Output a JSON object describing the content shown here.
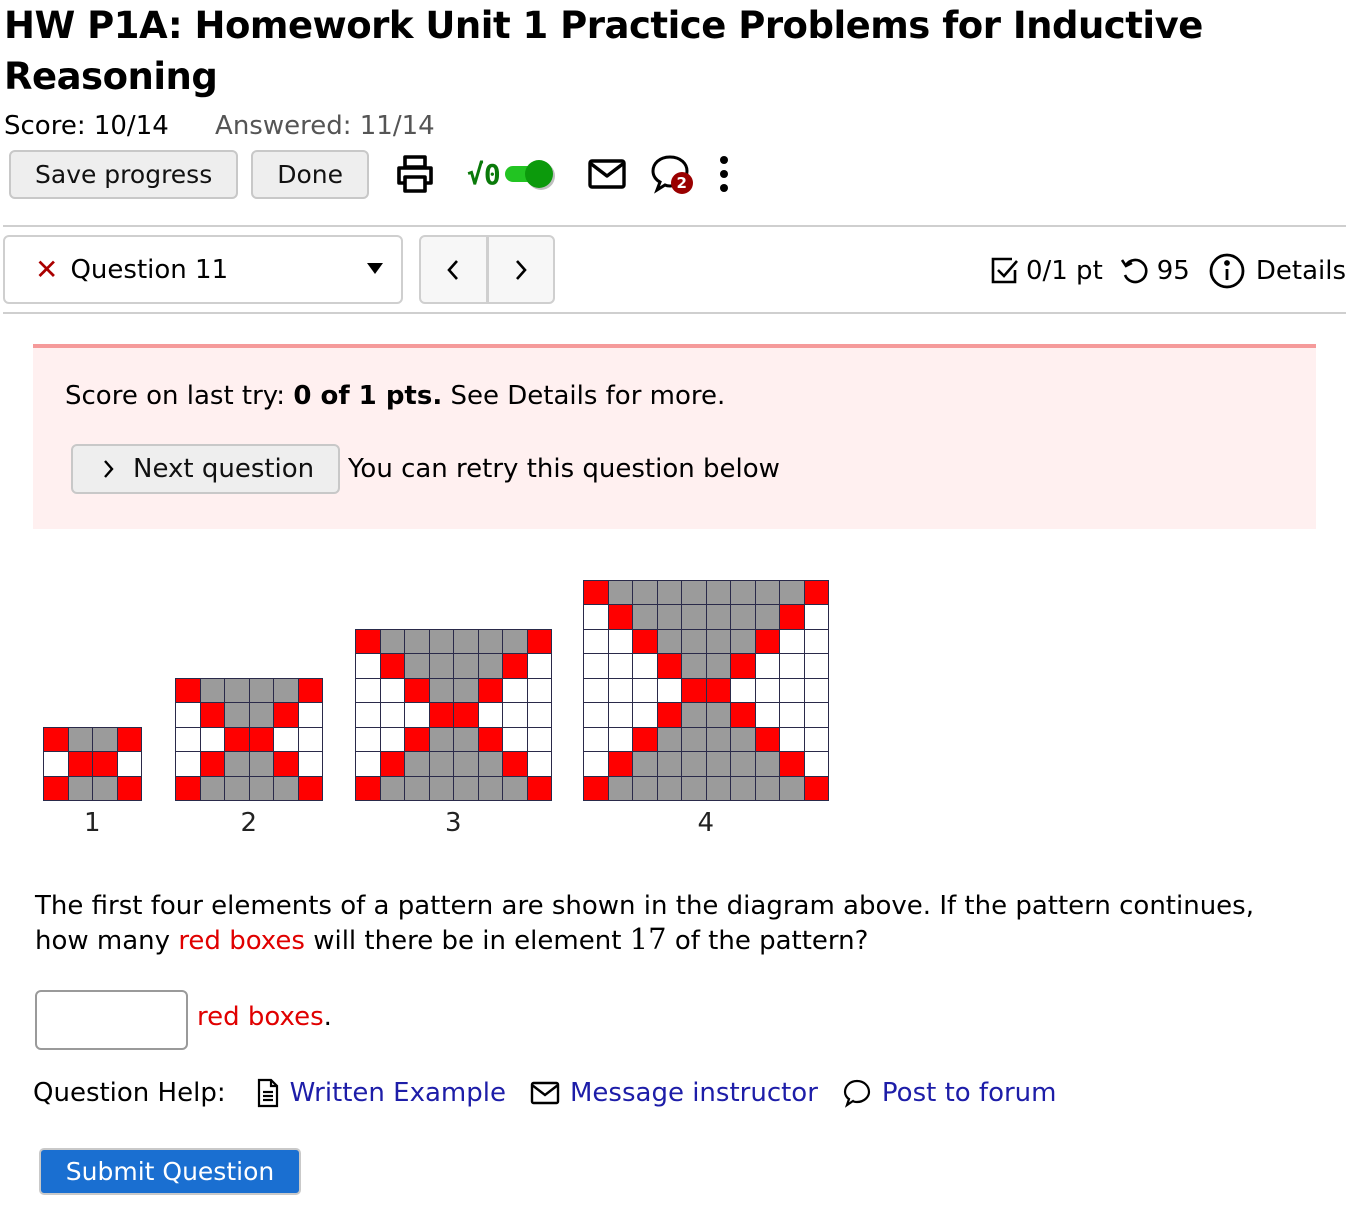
{
  "page": {
    "title": "HW P1A: Homework Unit 1 Practice Problems for Inductive Reasoning",
    "score": "Score: 10/14",
    "answered": "Answered: 11/14"
  },
  "toolbar": {
    "save_label": "Save progress",
    "done_label": "Done",
    "icons": [
      "print-icon",
      "math-entry-toggle",
      "mail-icon",
      "chat-notifications-icon",
      "more-options-icon"
    ],
    "math_toggle_label": "√0",
    "math_toggle_on": true,
    "notification_count": "2"
  },
  "question_nav": {
    "selected": "Question 11",
    "status_icon": "incorrect-x-icon",
    "prev_icon": "chevron-left-icon",
    "next_icon": "chevron-right-icon",
    "points": "0/1 pt",
    "retries": "95",
    "details_label": "Details"
  },
  "banner": {
    "prefix": "Score on last try: ",
    "score_bold": "0 of 1 pts.",
    "suffix": " See Details for more.",
    "next_button": "Next question",
    "retry_text": "You can retry this question below"
  },
  "diagram": {
    "colors": {
      "red": "#ff0000",
      "gray": "#9b9b9b",
      "white": "#ffffff"
    },
    "elements": [
      {
        "label": "1",
        "rows": [
          "RGGR",
          "WRRW",
          "RGGR"
        ]
      },
      {
        "label": "2",
        "rows": [
          "RGGGGR",
          "WRGGRW",
          "WWRRWW",
          "WRGGRW",
          "RGGGGR"
        ]
      },
      {
        "label": "3",
        "rows": [
          "RGGGGGGR",
          "WRGGGGRW",
          "WWRGGRWW",
          "WWWRRWWW",
          "WWRGGRWW",
          "WRGGGGRW",
          "RGGGGGGR"
        ]
      },
      {
        "label": "4",
        "rows": [
          "RGGGGGGGGR",
          "WRGGGGGGRW",
          "WWRGGGGRWW",
          "WWWRGGRWWW",
          "WWWWRRWWWW",
          "WWWRGGRWWW",
          "WWRGGGGRWW",
          "WRGGGGGGRW",
          "RGGGGGGGGR"
        ]
      }
    ]
  },
  "question": {
    "text_a": "The first four elements of a pattern are shown in the diagram above. If the pattern continues, how many ",
    "red_phrase": "red boxes",
    "text_b": " will there be in element ",
    "element_number": "17",
    "text_c": " of the pattern?",
    "answer_value": "",
    "answer_suffix_red": "red boxes",
    "answer_suffix_end": "."
  },
  "help": {
    "label": "Question Help:",
    "links": [
      "Written Example",
      "Message instructor",
      "Post to forum"
    ]
  },
  "submit_label": "Submit Question"
}
